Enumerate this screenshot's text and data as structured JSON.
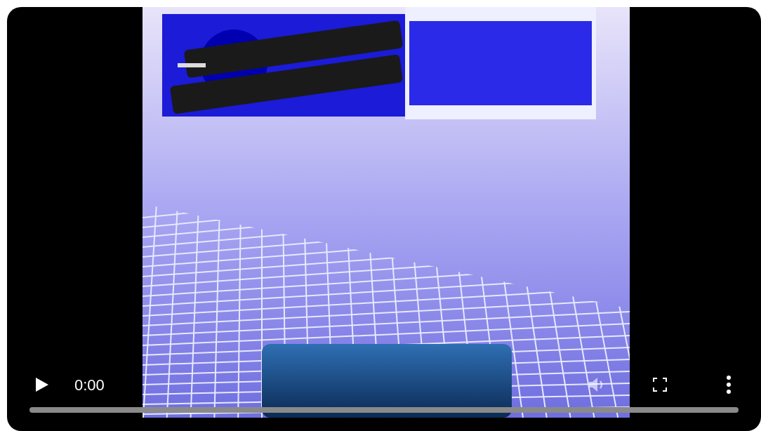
{
  "video_player": {
    "controls": {
      "time": "0:00",
      "volume_disabled": true
    }
  }
}
